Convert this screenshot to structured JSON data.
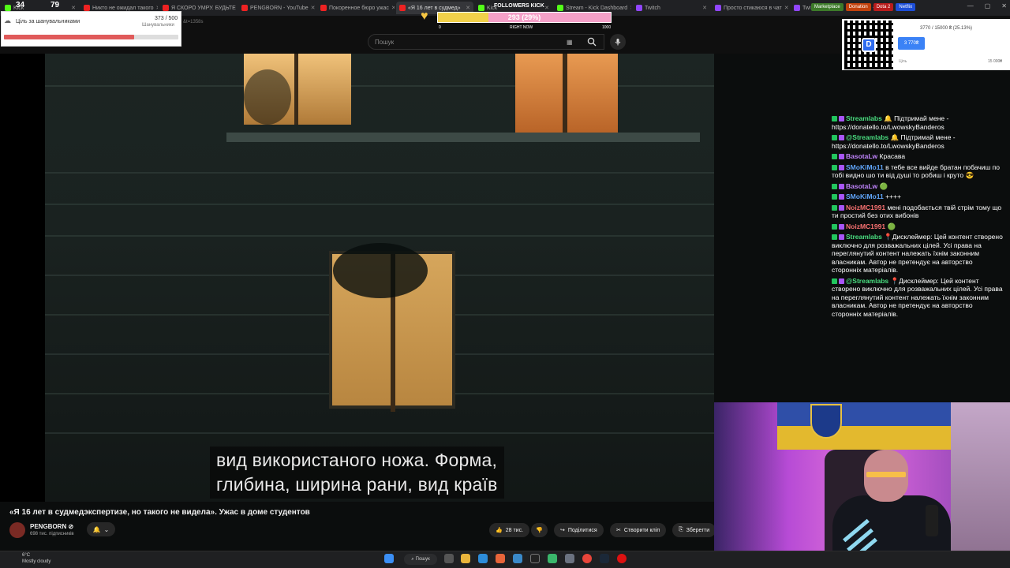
{
  "browser": {
    "tabs": [
      {
        "label": "Kick",
        "icon": "kick-icon"
      },
      {
        "label": "Никто не ожидал такого",
        "icon": "youtube-icon"
      },
      {
        "label": "Я СКОРО УМРУ. БУДЬТЕ",
        "icon": "youtube-icon"
      },
      {
        "label": "PENGBORN - YouTube",
        "icon": "youtube-icon"
      },
      {
        "label": "Покоренное бюро ужас",
        "icon": "youtube-icon"
      },
      {
        "label": "«Я 16 лет в судмед»",
        "icon": "youtube-icon",
        "active": true
      },
      {
        "label": "Kick",
        "icon": "kick-icon"
      },
      {
        "label": "Stream - Kick Dashboard",
        "icon": "kick-icon"
      },
      {
        "label": "Twitch",
        "icon": "twitch-icon"
      },
      {
        "label": "Просто стикаюся в чат",
        "icon": "twitch-icon"
      },
      {
        "label": "Twitch",
        "icon": "twitch-icon"
      }
    ],
    "bookmarks": [
      {
        "label": "Marketplace",
        "color": "#3d7a2a"
      },
      {
        "label": "Donation",
        "color": "#c2410c"
      },
      {
        "label": "Dota 2",
        "color": "#b91c1c"
      },
      {
        "label": "Netflix",
        "color": "#1d4ed8"
      }
    ],
    "address_fragment": "&t=1358s"
  },
  "youtube": {
    "search_placeholder": "Пошук",
    "subtitle_line1": "вид використаного ножа. Форма,",
    "subtitle_line2": "глибина, ширина рани, вид країв",
    "video_title": "«Я 16 лет в судмедэкспертизе, но такого не видела». Ужас в доме студентов",
    "channel_name": "PENGBORN",
    "channel_subs": "698 тис. підписників",
    "likes": "28 тис.",
    "share": "Поділитися",
    "clip": "Створити кліп",
    "save": "Зберегти"
  },
  "overlays": {
    "counter_left": "34",
    "counter_right": "79",
    "goal_title": "Ціль за шанувальниками",
    "goal_count": "373 / 500",
    "goal_sub": "Шанувальники",
    "goal_fraction": 0.746,
    "kick_title": "FOLLOWERS KICK",
    "kick_value": "293 (29%)",
    "kick_fraction": 0.29,
    "kick_min": "0",
    "kick_mid": "RIGHT NOW",
    "kick_max": "1000",
    "donation_progress": "3770 / 15000 ₴ (25.13%)",
    "donation_amount": "3 770₴",
    "donation_min": "Ціль",
    "donation_max": "15 000₴"
  },
  "chat": [
    {
      "user": "Streamlabs",
      "color": "#4ade80",
      "text": "🔔 Підтримай мене - https://donatello.to/LwowskyBanderos"
    },
    {
      "user": "@Streamlabs",
      "color": "#4ade80",
      "text": "🔔 Підтримай мене - https://donatello.to/LwowskyBanderos"
    },
    {
      "user": "BasotaLw",
      "color": "#c084fc",
      "text": "Красава"
    },
    {
      "user": "SMoKiMo11",
      "color": "#60a5fa",
      "text": "в тебе все вийде братан побачиш по тобі видно шо ти від душі то робиш і круто 😎"
    },
    {
      "user": "BasotaLw",
      "color": "#c084fc",
      "text": "🟢"
    },
    {
      "user": "SMoKiMo11",
      "color": "#60a5fa",
      "text": "++++"
    },
    {
      "user": "NoizMC1991",
      "color": "#f87171",
      "text": "мені подобається твій стрім тому що ти простий без отих вибонів"
    },
    {
      "user": "NoizMC1991",
      "color": "#f87171",
      "text": "🟢"
    },
    {
      "user": "Streamlabs",
      "color": "#4ade80",
      "text": "📍Дисклеймер: Цей контент створено виключно для розважальних цілей. Усі права на переглянутий контент належать їхнім законним власникам. Автор не претендує на авторство сторонніх матеріалів."
    },
    {
      "user": "@Streamlabs",
      "color": "#4ade80",
      "text": "📍Дисклеймер: Цей контент створено виключно для розважальних цілей. Усі права на переглянутий контент належать їхнім законним власникам. Автор не претендує на авторство сторонніх матеріалів."
    }
  ],
  "taskbar": {
    "weather_temp": "6°C",
    "weather_desc": "Mostly cloudy",
    "search_label": "Пошук"
  }
}
